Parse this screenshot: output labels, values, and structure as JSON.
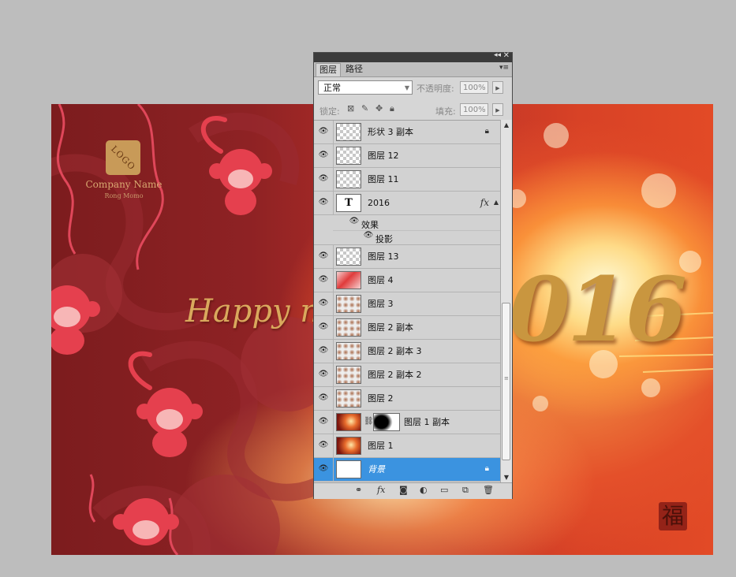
{
  "canvas": {
    "logo_text": "LOGO",
    "company_name": "Company Name",
    "company_sub": "Rong Momo",
    "greeting": "Happy ne",
    "year": "016",
    "fu_char": "福"
  },
  "panel": {
    "tabs": [
      {
        "label": "图层"
      },
      {
        "label": "路径"
      }
    ],
    "blend_mode": "正常",
    "opacity_label": "不透明度:",
    "opacity_value": "100%",
    "lock_label": "锁定:",
    "fill_label": "填充:",
    "fill_value": "100%",
    "layers": [
      {
        "name": "形状 3 副本",
        "locked": true
      },
      {
        "name": "图层 12"
      },
      {
        "name": "图层 11"
      },
      {
        "name": "2016",
        "type": "text",
        "has_fx": true,
        "effects_label": "效果",
        "effect": "投影"
      },
      {
        "name": "图层 13"
      },
      {
        "name": "图层 4"
      },
      {
        "name": "图层 3"
      },
      {
        "name": "图层 2 副本"
      },
      {
        "name": "图层 2 副本 3"
      },
      {
        "name": "图层 2 副本 2"
      },
      {
        "name": "图层 2"
      },
      {
        "name": "图层 1 副本",
        "has_mask": true
      },
      {
        "name": "图层 1"
      },
      {
        "name": "背景",
        "locked": true,
        "selected": true
      }
    ],
    "fx_symbol": "fx",
    "text_thumb": "T"
  },
  "colors": {
    "selection": "#3b93e0",
    "panel_bg": "#d6d6d6",
    "workspace": "#bdbdbd"
  }
}
